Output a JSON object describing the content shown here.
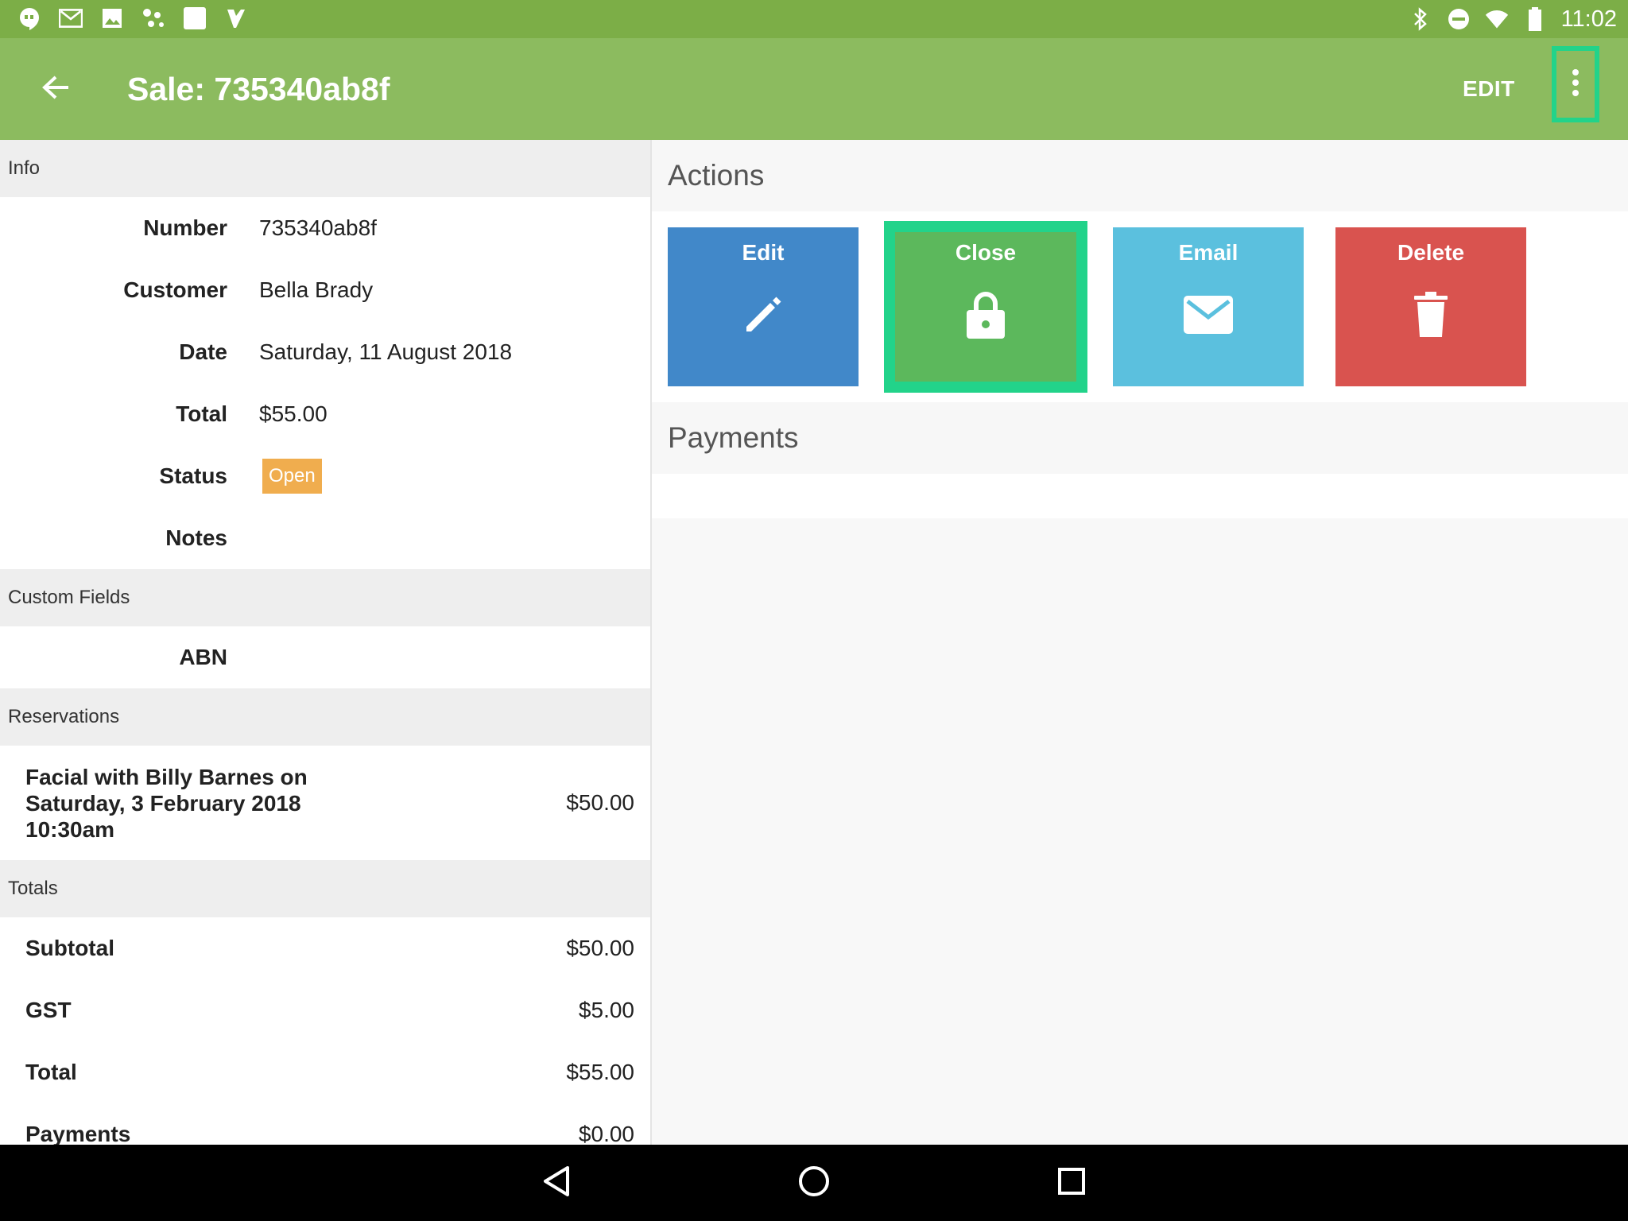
{
  "status_bar": {
    "time": "11:02",
    "left_icons": [
      "hangouts-icon",
      "gmail-icon",
      "photos-icon",
      "app-icon",
      "square-icon",
      "checkmark-icon"
    ],
    "right_icons": [
      "bluetooth-icon",
      "do-not-disturb-icon",
      "wifi-icon",
      "battery-icon"
    ]
  },
  "app_bar": {
    "title": "Sale: 735340ab8f",
    "edit_label": "EDIT"
  },
  "info": {
    "header": "Info",
    "fields": [
      {
        "label": "Number",
        "value": "735340ab8f"
      },
      {
        "label": "Customer",
        "value": "Bella Brady"
      },
      {
        "label": "Date",
        "value": "Saturday, 11 August 2018"
      },
      {
        "label": "Total",
        "value": "$55.00"
      }
    ],
    "status_label": "Status",
    "status_value": "Open",
    "notes_label": "Notes"
  },
  "custom_fields": {
    "header": "Custom Fields",
    "abn_label": "ABN"
  },
  "reservations": {
    "header": "Reservations",
    "items": [
      {
        "description": "Facial with Billy Barnes on Saturday, 3 February 2018 10:30am",
        "price": "$50.00"
      }
    ]
  },
  "totals": {
    "header": "Totals",
    "rows": [
      {
        "label": "Subtotal",
        "value": "$50.00"
      },
      {
        "label": "GST",
        "value": "$5.00"
      },
      {
        "label": "Total",
        "value": "$55.00"
      },
      {
        "label": "Payments",
        "value": "$0.00"
      }
    ]
  },
  "actions": {
    "title": "Actions",
    "buttons": [
      {
        "label": "Edit",
        "icon": "pencil-icon",
        "color": "#4188c9"
      },
      {
        "label": "Close",
        "icon": "lock-icon",
        "color": "#5cb85c"
      },
      {
        "label": "Email",
        "icon": "envelope-icon",
        "color": "#5bc0de"
      },
      {
        "label": "Delete",
        "icon": "trash-icon",
        "color": "#d9534f"
      }
    ]
  },
  "payments": {
    "title": "Payments"
  },
  "colors": {
    "status_bar": "#7cae47",
    "app_bar": "#8cbb5f",
    "highlight": "#22d38a",
    "badge_open": "#f0ad4e"
  }
}
